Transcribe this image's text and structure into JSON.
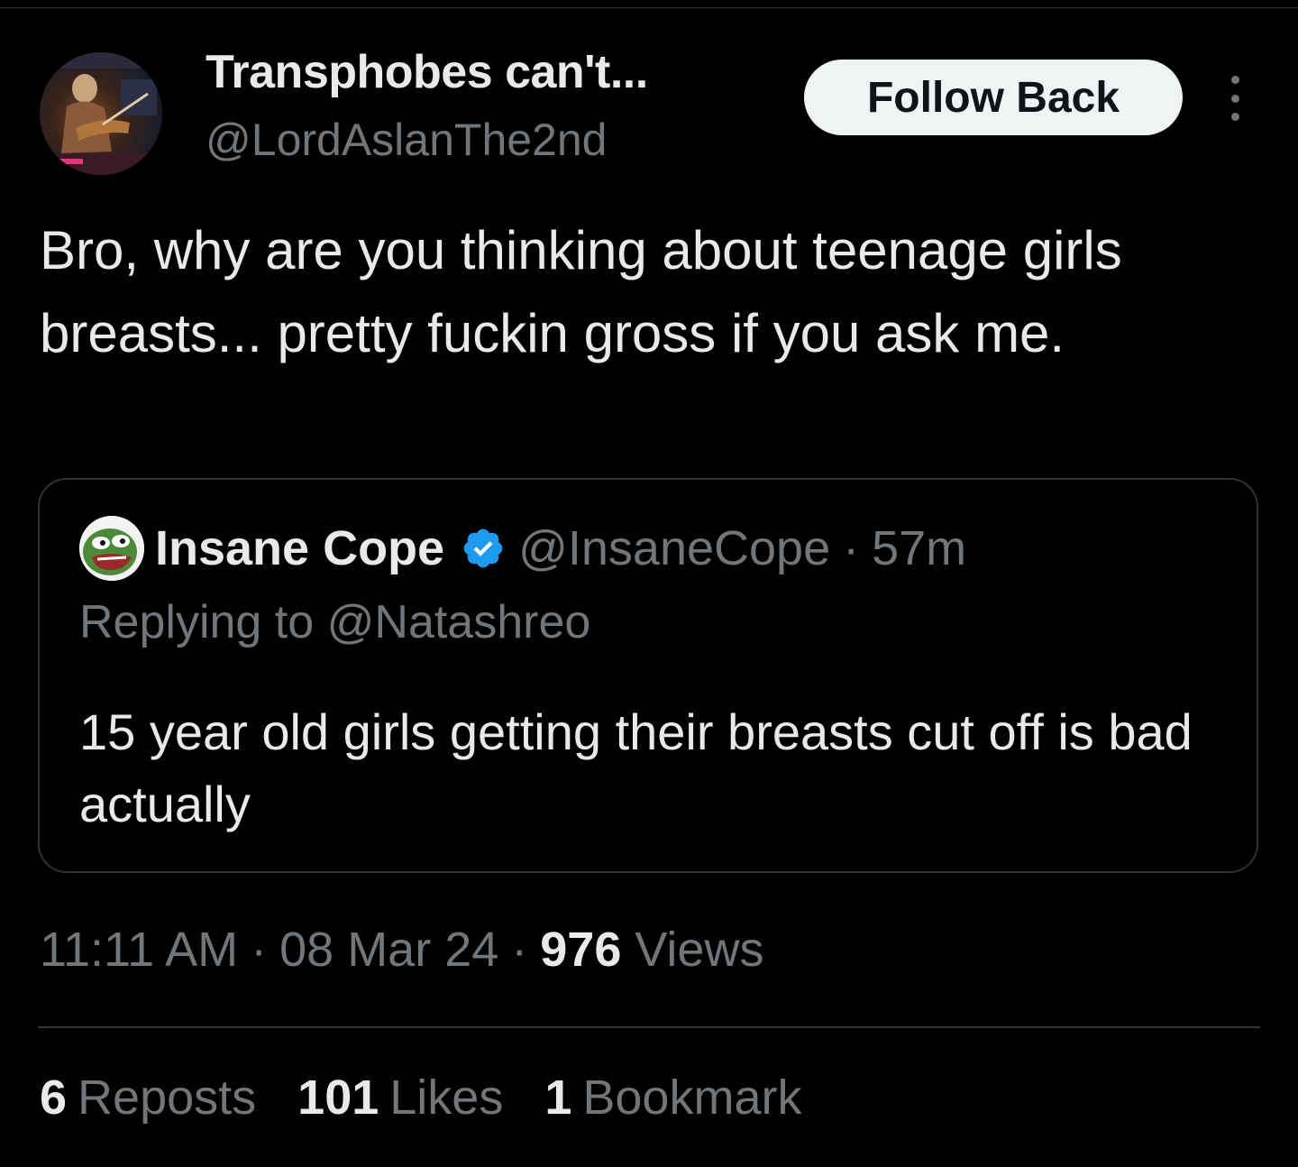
{
  "tweet": {
    "author": {
      "display_name": "Transphobes can't...",
      "handle": "@LordAslanThe2nd"
    },
    "follow_button_label": "Follow Back",
    "text": "Bro, why are you thinking about teenage girls breasts... pretty fuckin gross if you ask me.",
    "time": "11:11 AM",
    "date": "08 Mar 24",
    "views_count": "976",
    "views_label": "Views",
    "separator": "·"
  },
  "quote": {
    "display_name": "Insane Cope",
    "handle": "@InsaneCope",
    "separator": "·",
    "time_ago": "57m",
    "replying_to": "Replying to @Natashreo",
    "text": "15 year old girls getting their breasts cut off is bad actually"
  },
  "stats": {
    "reposts_count": "6",
    "reposts_label": "Reposts",
    "likes_count": "101",
    "likes_label": "Likes",
    "bookmarks_count": "1",
    "bookmarks_label": "Bookmark"
  },
  "colors": {
    "background": "#000000",
    "text_primary": "#e7e9ea",
    "text_secondary": "#71767b",
    "border": "#2f3336",
    "verified": "#1d9bf0",
    "button_bg": "#eff3f4"
  },
  "icons": {
    "more": "more-options-icon",
    "verified": "verified-badge-icon"
  }
}
